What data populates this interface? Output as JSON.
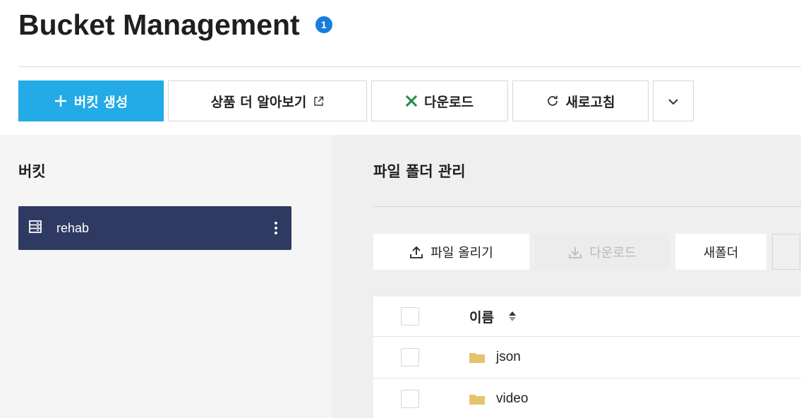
{
  "header": {
    "title": "Bucket Management",
    "help_badge": "1"
  },
  "toolbar": {
    "create_label": "버킷 생성",
    "learn_more_label": "상품 더 알아보기",
    "download_label": "다운로드",
    "refresh_label": "새로고침",
    "icons": {
      "create": "plus-icon",
      "learn_more": "external-link-icon",
      "download": "excel-icon",
      "refresh": "refresh-icon",
      "more": "chevron-down-icon"
    }
  },
  "colors": {
    "primary": "#22abe6",
    "selected_bucket": "#2f3a63",
    "badge": "#1a7ddc",
    "excel": "#1f8b3f",
    "folder": "#e6c36a"
  },
  "bucket_panel": {
    "title": "버킷",
    "buckets": [
      {
        "label": "rehab",
        "icon": "bucket-storage-icon",
        "selected": true
      }
    ]
  },
  "file_panel": {
    "title": "파일 폴더 관리",
    "actions": {
      "upload_label": "파일 올리기",
      "download_label": "다운로드",
      "download_disabled": true,
      "new_folder_label": "새폴더"
    },
    "table": {
      "columns": [
        "이름"
      ],
      "rows": [
        {
          "name": "json",
          "type": "folder"
        },
        {
          "name": "video",
          "type": "folder"
        }
      ]
    }
  }
}
